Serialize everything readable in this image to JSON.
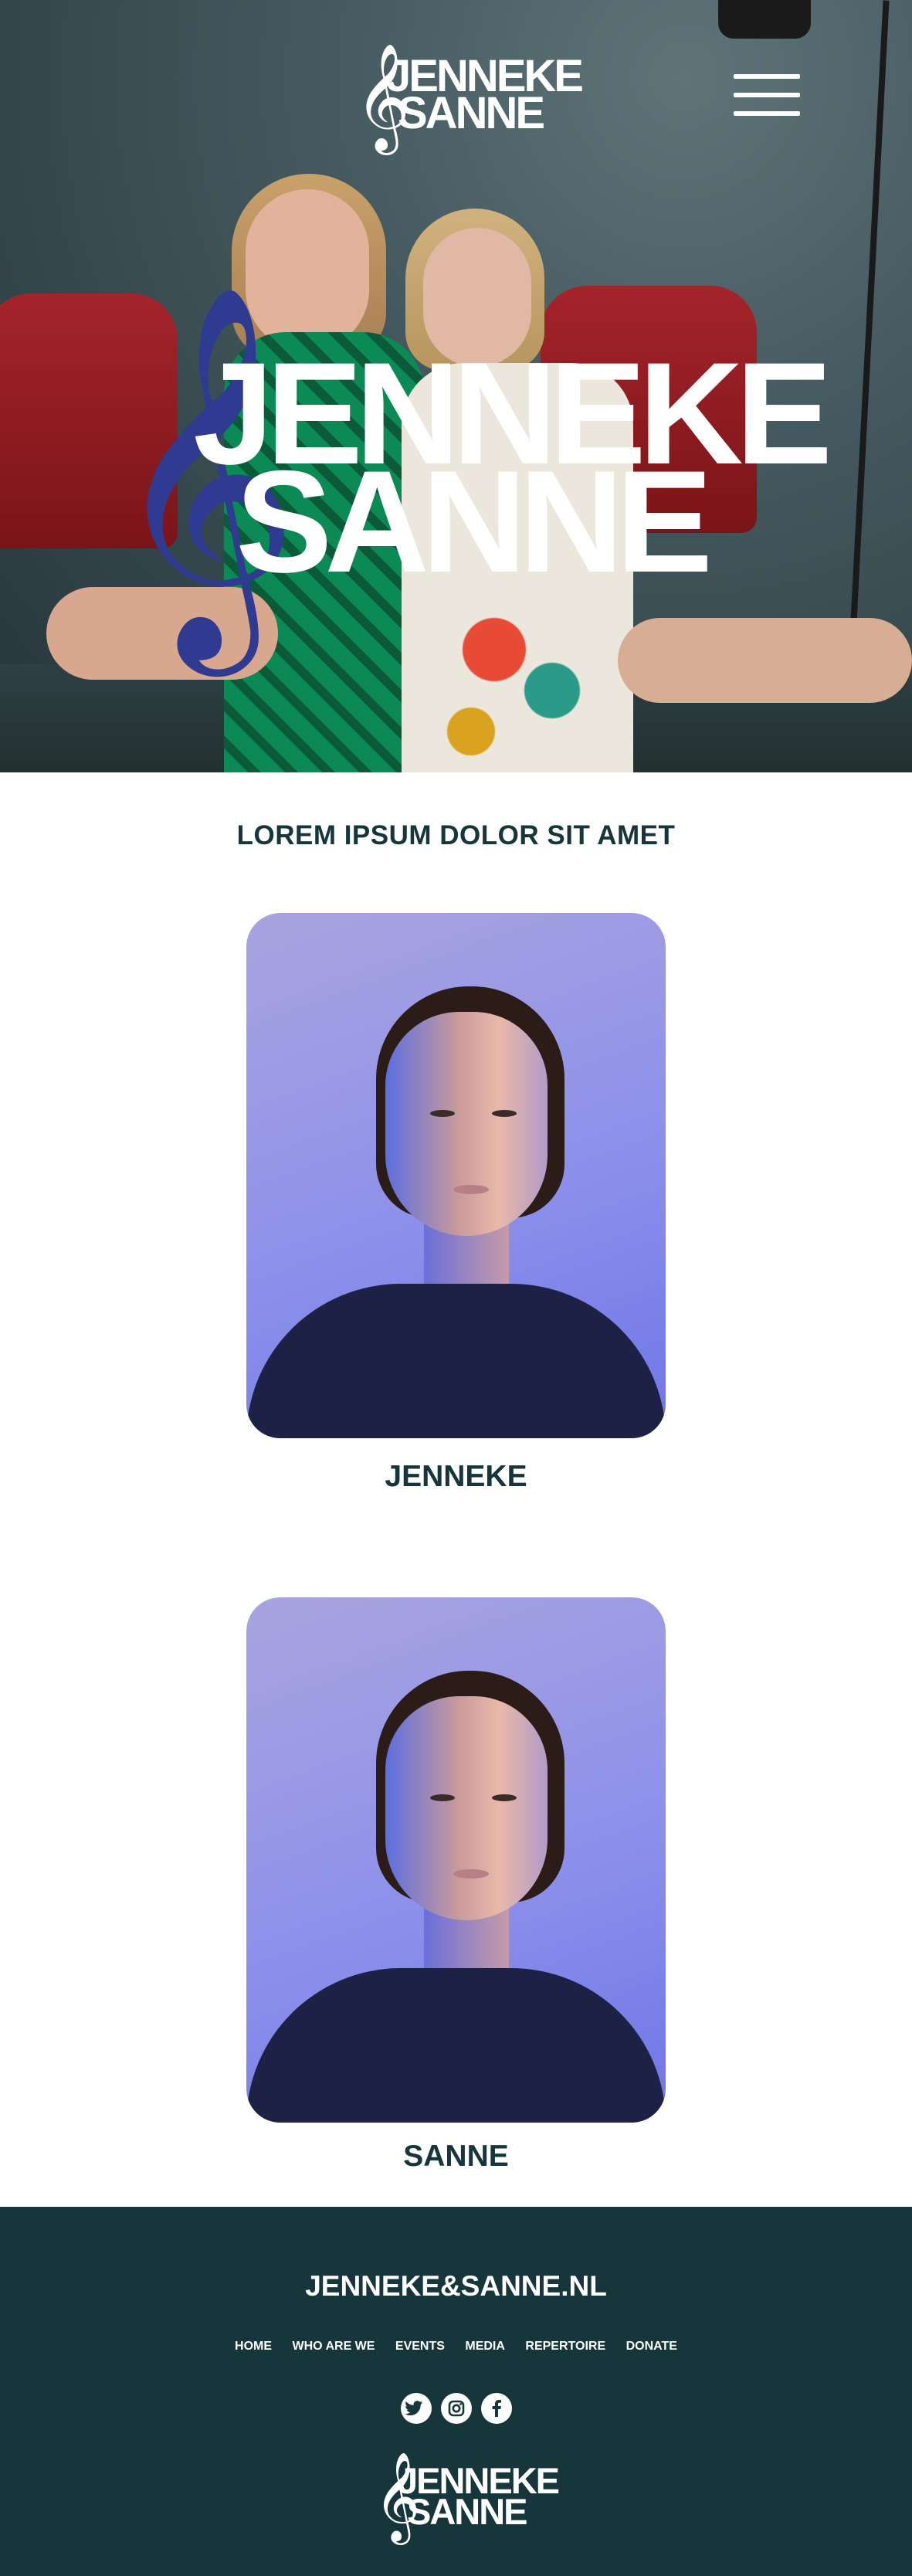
{
  "brand": {
    "line1": "JENNEKE",
    "line2": "SANNE",
    "clef": "𝄞"
  },
  "hero": {
    "headline_line1": "JENNEKE",
    "headline_line2": "SANNE"
  },
  "tagline": "LOREM IPSUM DOLOR SIT AMET",
  "profiles": [
    {
      "name": "JENNEKE"
    },
    {
      "name": "SANNE"
    }
  ],
  "footer": {
    "site": "JENNEKE&SANNE.NL",
    "nav": [
      "HOME",
      "WHO ARE WE",
      "EVENTS",
      "MEDIA",
      "REPERTOIRE",
      "DONATE"
    ],
    "social_icons": [
      "twitter-icon",
      "instagram-icon",
      "facebook-icon"
    ]
  },
  "colors": {
    "dark_teal": "#17363b",
    "clef_blue": "#2f3a91",
    "white": "#ffffff"
  }
}
